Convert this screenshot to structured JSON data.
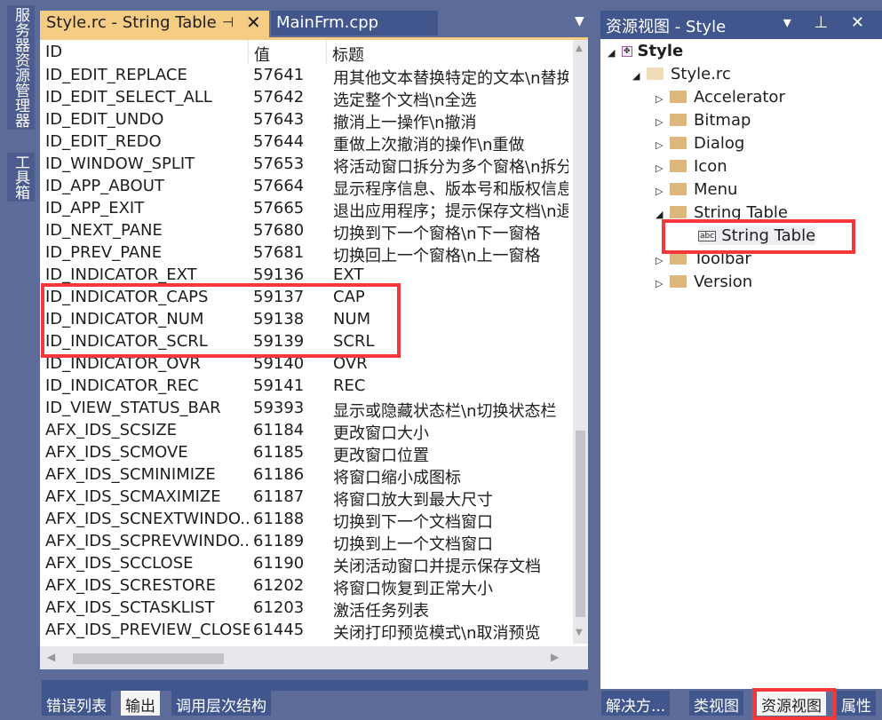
{
  "left_sidebar": {
    "server_explorer": "服务器资源管理器",
    "toolbox": "工具箱"
  },
  "doc_tabs": {
    "active": "Style.rc - String Table",
    "inactive": "MainFrm.cpp",
    "pin_icon": "⊣",
    "close_icon": "✕",
    "dropdown_icon": "▼"
  },
  "table": {
    "headers": [
      "ID",
      "值",
      "标题"
    ],
    "rows": [
      [
        "ID_EDIT_REPLACE",
        "57641",
        "用其他文本替换特定的文本\\n替换"
      ],
      [
        "ID_EDIT_SELECT_ALL",
        "57642",
        "选定整个文档\\n全选"
      ],
      [
        "ID_EDIT_UNDO",
        "57643",
        "撤消上一操作\\n撤消"
      ],
      [
        "ID_EDIT_REDO",
        "57644",
        "重做上次撤消的操作\\n重做"
      ],
      [
        "ID_WINDOW_SPLIT",
        "57653",
        "将活动窗口拆分为多个窗格\\n拆分"
      ],
      [
        "ID_APP_ABOUT",
        "57664",
        "显示程序信息、版本号和版权信息"
      ],
      [
        "ID_APP_EXIT",
        "57665",
        "退出应用程序；提示保存文档\\n退出"
      ],
      [
        "ID_NEXT_PANE",
        "57680",
        "切换到下一个窗格\\n下一窗格"
      ],
      [
        "ID_PREV_PANE",
        "57681",
        "切换回上一个窗格\\n上一窗格"
      ],
      [
        "ID_INDICATOR_EXT",
        "59136",
        "EXT"
      ],
      [
        "ID_INDICATOR_CAPS",
        "59137",
        "CAP"
      ],
      [
        "ID_INDICATOR_NUM",
        "59138",
        "NUM"
      ],
      [
        "ID_INDICATOR_SCRL",
        "59139",
        "SCRL"
      ],
      [
        "ID_INDICATOR_OVR",
        "59140",
        "OVR"
      ],
      [
        "ID_INDICATOR_REC",
        "59141",
        "REC"
      ],
      [
        "ID_VIEW_STATUS_BAR",
        "59393",
        "显示或隐藏状态栏\\n切换状态栏"
      ],
      [
        "AFX_IDS_SCSIZE",
        "61184",
        "更改窗口大小"
      ],
      [
        "AFX_IDS_SCMOVE",
        "61185",
        "更改窗口位置"
      ],
      [
        "AFX_IDS_SCMINIMIZE",
        "61186",
        "将窗口缩小成图标"
      ],
      [
        "AFX_IDS_SCMAXIMIZE",
        "61187",
        "将窗口放大到最大尺寸"
      ],
      [
        "AFX_IDS_SCNEXTWINDO...",
        "61188",
        "切换到下一个文档窗口"
      ],
      [
        "AFX_IDS_SCPREVWINDO...",
        "61189",
        "切换到上一个文档窗口"
      ],
      [
        "AFX_IDS_SCCLOSE",
        "61190",
        "关闭活动窗口并提示保存文档"
      ],
      [
        "AFX_IDS_SCRESTORE",
        "61202",
        "将窗口恢复到正常大小"
      ],
      [
        "AFX_IDS_SCTASKLIST",
        "61203",
        "激活任务列表"
      ],
      [
        "AFX_IDS_PREVIEW_CLOSE",
        "61445",
        "关闭打印预览模式\\n取消预览"
      ]
    ]
  },
  "bottom_tabs": [
    "错误列表",
    "输出",
    "调用层次结构"
  ],
  "bottom_selected": "输出",
  "resource_view": {
    "title": "资源视图 - Style",
    "buttons": "▾ ⊥ ✕",
    "tree": {
      "root": "Style",
      "rc": "Style.rc",
      "folders": [
        "Accelerator",
        "Bitmap",
        "Dialog",
        "Icon",
        "Menu",
        "String Table",
        "Toolbar",
        "Version"
      ],
      "child": "String Table"
    }
  },
  "right_tabs": [
    "解决方...",
    "类视图",
    "资源视图",
    "属性"
  ],
  "colors": {
    "accent": "#f5cc84",
    "chrome": "#5d6b99",
    "tab": "#40568d",
    "highlight": "#f5393b"
  }
}
